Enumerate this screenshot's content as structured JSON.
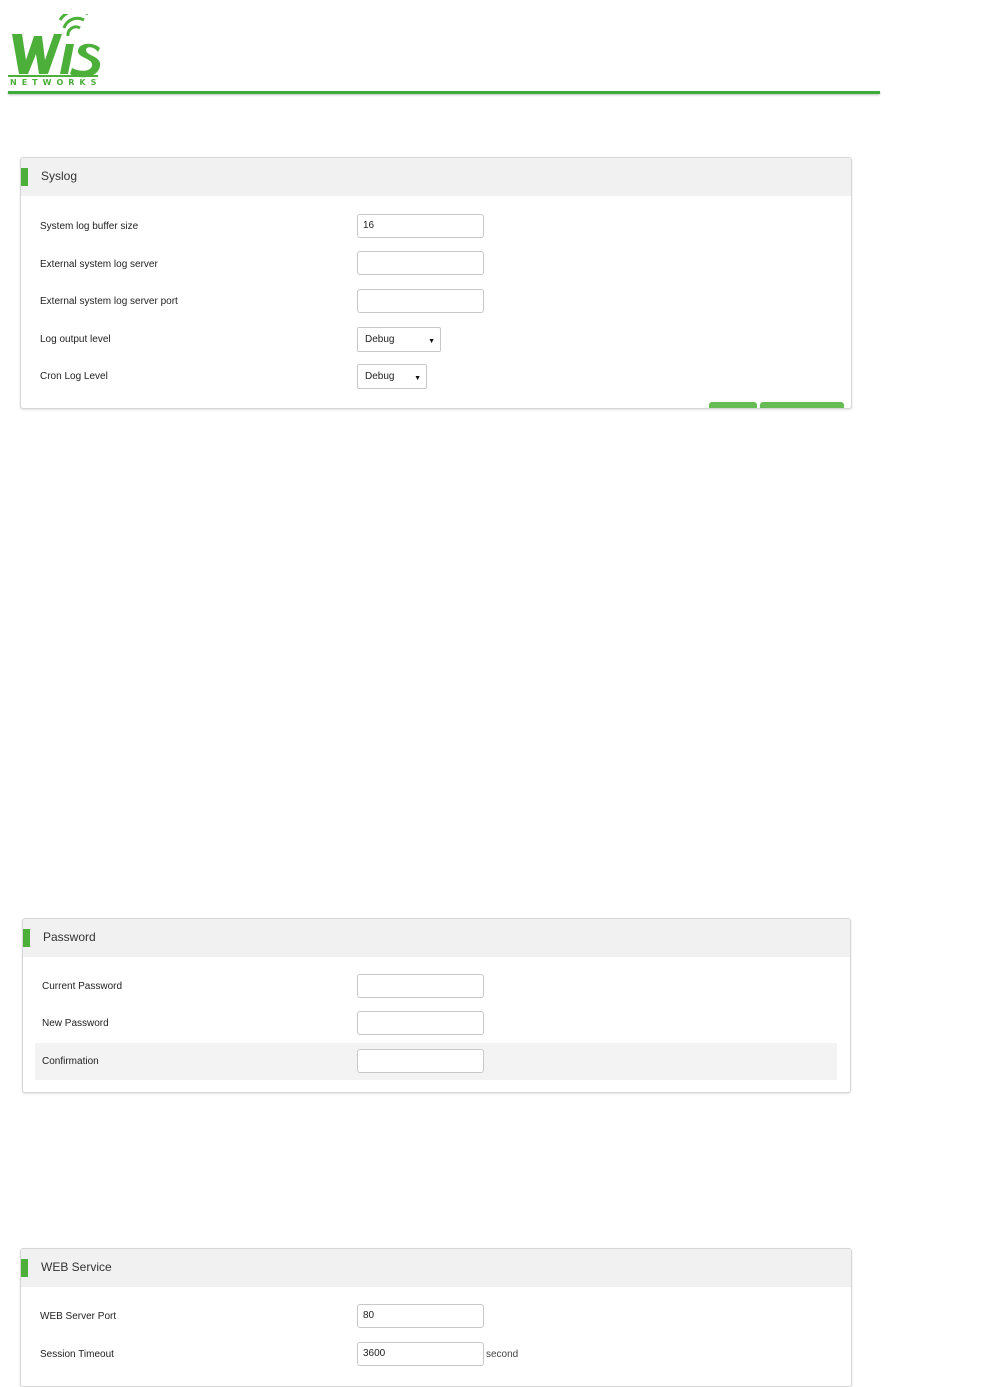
{
  "brand": {
    "logo_text": "WiS",
    "logo_sub": "NETWORKS",
    "accent": "#3cac3a"
  },
  "syslog": {
    "title": "Syslog",
    "buffer_size_label": "System log buffer size",
    "buffer_size_value": "16",
    "ext_server_label": "External system log server",
    "ext_server_value": "",
    "ext_port_label": "External system log server port",
    "ext_port_value": "",
    "log_level_label": "Log output level",
    "log_level_value": "Debug",
    "cron_level_label": "Cron Log Level",
    "cron_level_value": "Debug"
  },
  "password": {
    "title": "Password",
    "current_label": "Current Password",
    "new_label": "New Password",
    "confirm_label": "Confirmation"
  },
  "web": {
    "title": "WEB Service",
    "port_label": "WEB Server Port",
    "port_value": "80",
    "timeout_label": "Session Timeout",
    "timeout_value": "3600",
    "timeout_unit": "second"
  }
}
